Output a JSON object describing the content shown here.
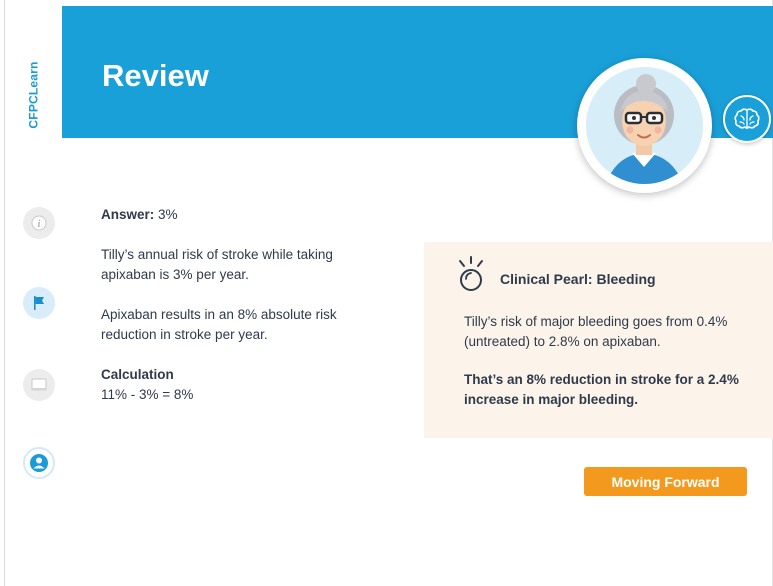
{
  "sidebar": {
    "logo_text": "CFPCLearn",
    "buttons": [
      {
        "name": "info-icon"
      },
      {
        "name": "flag-icon"
      },
      {
        "name": "note-icon"
      },
      {
        "name": "user-icon"
      }
    ]
  },
  "header": {
    "title": "Review",
    "avatar_icon": "grandmother-avatar",
    "brain_icon": "brain-icon"
  },
  "answer": {
    "label": "Answer:",
    "value": "3%",
    "para1": "Tilly’s annual risk of stroke while taking apixaban is 3% per year.",
    "para2": "Apixaban results in an 8% absolute risk reduction in stroke per year.",
    "calc_title": "Calculation",
    "calc_formula": "11% - 3% = 8%"
  },
  "pearl": {
    "icon": "lightbulb-icon",
    "title": "Clinical Pearl: Bleeding",
    "p1": "Tilly’s risk of major bleeding goes from 0.4% (untreated) to 2.8% on apixaban.",
    "p2": "That’s an 8% reduction in stroke for a 2.4% increase in major bleeding."
  },
  "footer": {
    "next_label": "Moving Forward"
  },
  "colors": {
    "header_blue": "#1aa0d8",
    "accent_orange": "#f39a1e",
    "pearl_bg": "#fcf4ea",
    "text": "#2f3a4a"
  }
}
